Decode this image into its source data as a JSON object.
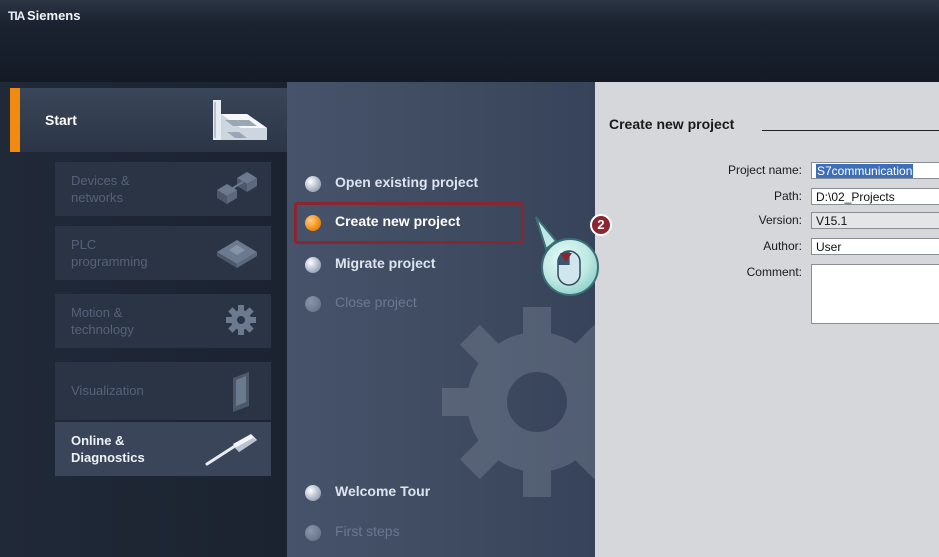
{
  "app": {
    "logo_text": "TIA",
    "title": "Siemens"
  },
  "nav": {
    "start_label": "Start",
    "items": [
      {
        "label": "Devices &\nnetworks",
        "enabled": false,
        "icon": "devices-networks-icon"
      },
      {
        "label": "PLC\nprogramming",
        "enabled": false,
        "icon": "plc-icon"
      },
      {
        "label": "Motion &\ntechnology",
        "enabled": false,
        "icon": "gear-icon"
      },
      {
        "label": "Visualization",
        "enabled": false,
        "icon": "panel-icon"
      },
      {
        "label": "Online &\nDiagnostics",
        "enabled": true,
        "icon": "screwdriver-icon"
      }
    ]
  },
  "actions": [
    {
      "label": "Open existing project"
    },
    {
      "label": "Create new project",
      "selected": true
    },
    {
      "label": "Migrate project"
    },
    {
      "label": "Close project",
      "disabled": true
    },
    {
      "label": "Welcome Tour"
    },
    {
      "label": "First steps",
      "disabled": true
    }
  ],
  "form": {
    "title": "Create new project",
    "fields": {
      "project_name": {
        "label": "Project name:",
        "value": "S7communication"
      },
      "path": {
        "label": "Path:",
        "value": "D:\\02_Projects"
      },
      "version": {
        "label": "Version:",
        "value": "V15.1"
      },
      "author": {
        "label": "Author:",
        "value": "User"
      },
      "comment": {
        "label": "Comment:",
        "value": ""
      }
    }
  },
  "callout": {
    "step_number": "2"
  },
  "colors": {
    "accent": "#f08a10",
    "highlight_frame": "#8b2630",
    "selection": "#3d6fb8"
  }
}
